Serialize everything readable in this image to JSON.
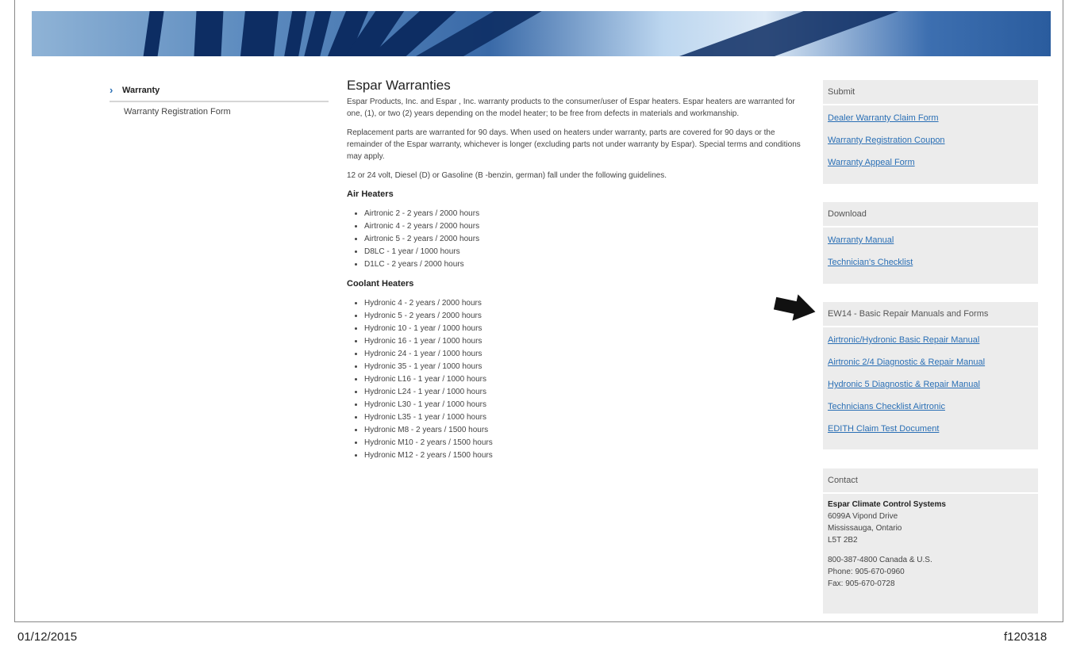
{
  "sidebar": {
    "active_item": "Warranty",
    "items": [
      "Warranty Registration Form"
    ]
  },
  "main": {
    "title": "Espar Warranties",
    "paragraphs": [
      "Espar Products, Inc. and Espar , Inc. warranty products to the consumer/user of Espar heaters. Espar heaters are warranted for one, (1), or two (2) years depending on the model heater; to be free from defects in materials and workmanship.",
      "Replacement parts are warranted for 90 days. When used on heaters under warranty, parts are covered for 90 days or the remainder of the Espar warranty, whichever is longer (excluding parts not under warranty by Espar). Special terms and conditions may apply.",
      "12 or 24 volt, Diesel (D) or Gasoline (B -benzin, german) fall under the following guidelines."
    ],
    "air_heaters": {
      "heading": "Air Heaters",
      "items": [
        "Airtronic 2 - 2 years / 2000 hours",
        "Airtronic 4 - 2 years / 2000 hours",
        "Airtronic 5 - 2 years / 2000 hours",
        "D8LC - 1 year / 1000 hours",
        "D1LC - 2 years / 2000 hours"
      ]
    },
    "coolant_heaters": {
      "heading": "Coolant Heaters",
      "items": [
        "Hydronic 4 - 2 years / 2000 hours",
        "Hydronic 5 - 2 years / 2000 hours",
        "Hydronic 10 - 1 year / 1000 hours",
        "Hydronic 16 - 1 year / 1000 hours",
        "Hydronic 24 - 1 year / 1000 hours",
        "Hydronic 35 - 1 year / 1000 hours",
        "Hydronic L16 - 1 year / 1000 hours",
        "Hydronic L24 - 1 year / 1000 hours",
        "Hydronic L30 - 1 year / 1000 hours",
        "Hydronic L35 - 1 year / 1000 hours",
        "Hydronic M8 - 2 years / 1500 hours",
        "Hydronic M10 - 2 years / 1500 hours",
        "Hydronic M12 - 2 years / 1500 hours"
      ]
    }
  },
  "right": {
    "submit": {
      "heading": "Submit",
      "links": [
        "Dealer Warranty Claim Form",
        "Warranty Registration Coupon",
        "Warranty Appeal Form"
      ]
    },
    "download": {
      "heading": "Download",
      "links": [
        "Warranty Manual",
        "Technician's Checklist"
      ]
    },
    "ew14": {
      "heading": "EW14 - Basic Repair Manuals and Forms",
      "links": [
        "Airtronic/Hydronic Basic Repair Manual",
        "Airtronic 2/4 Diagnostic & Repair Manual",
        "Hydronic 5 Diagnostic & Repair Manual",
        "Technicians Checklist Airtronic",
        "EDITH Claim Test Document"
      ]
    },
    "contact": {
      "heading": "Contact",
      "company": "Espar Climate Control Systems",
      "address": [
        "6099A Vipond Drive",
        "Mississauga, Ontario",
        "L5T 2B2"
      ],
      "phones": [
        "800-387-4800 Canada & U.S.",
        "Phone: 905-670-0960",
        "Fax: 905-670-0728"
      ]
    }
  },
  "footer": {
    "date": "01/12/2015",
    "code": "f120318"
  },
  "colors": {
    "link": "#2a6fb5",
    "panel_bg": "#ececec",
    "banner_dark": "#0d2d63"
  }
}
